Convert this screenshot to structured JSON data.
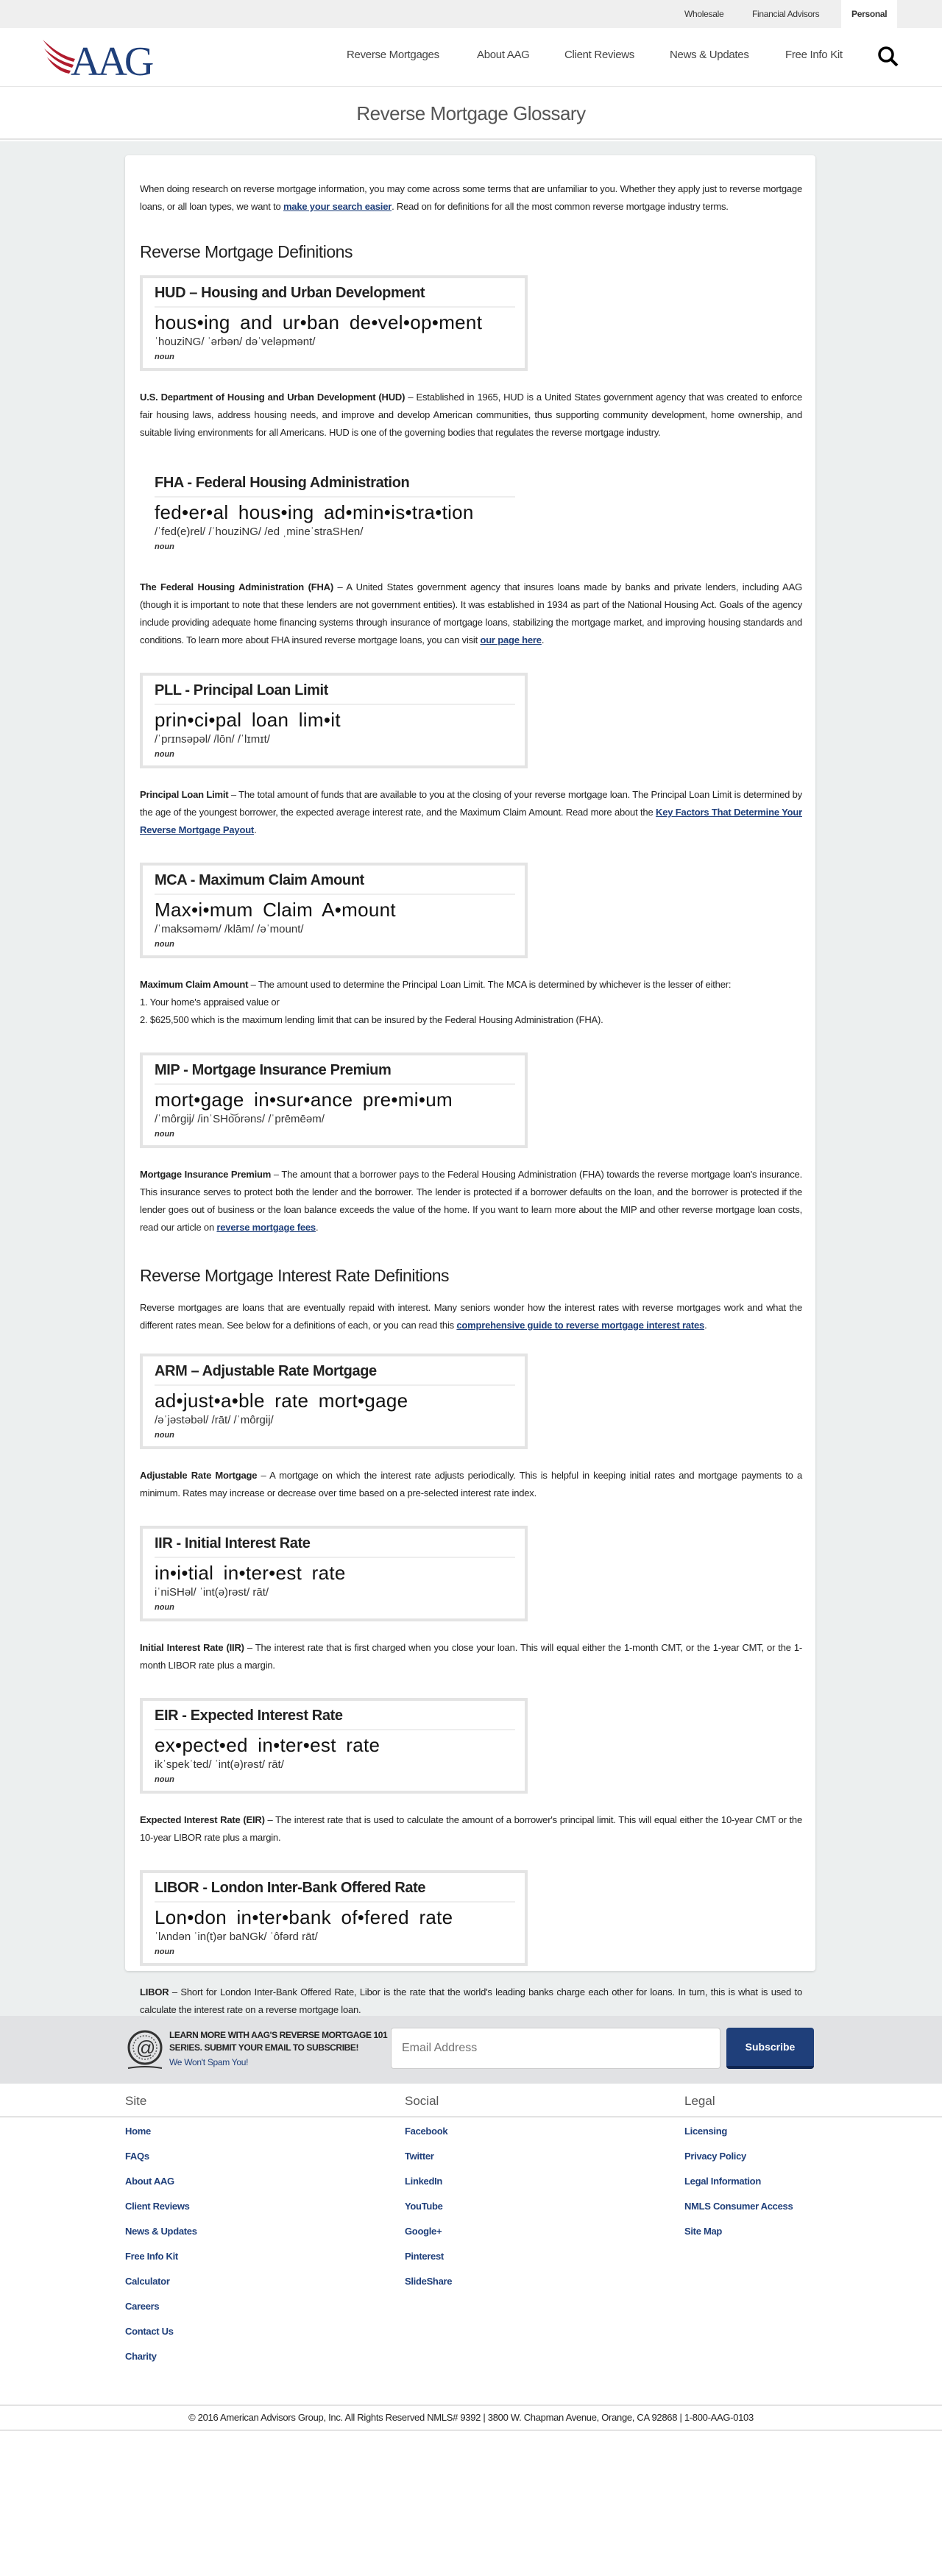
{
  "topbar": {
    "items": [
      {
        "label": "Wholesale"
      },
      {
        "label": "Financial Advisors"
      },
      {
        "label": "Personal",
        "active": true
      }
    ]
  },
  "header": {
    "logo": "AAG",
    "nav": [
      {
        "label": "Reverse Mortgages"
      },
      {
        "label": "About AAG"
      },
      {
        "label": "Client Reviews"
      },
      {
        "label": "News & Updates"
      },
      {
        "label": "Free Info Kit"
      }
    ],
    "search_icon": "search-icon"
  },
  "colors": {
    "brand_blue": "#1f3f7a",
    "brand_red": "#b01c2e",
    "page_bg": "#ecefef"
  },
  "page_title": "Reverse Mortgage Glossary",
  "intro": [
    {
      "t": "When doing research on reverse mortgage information, you may come across some terms that are unfamiliar to you. Whether they apply just to reverse mortgage loans, or all loan types, we want to "
    },
    {
      "link": "make your search easier"
    },
    {
      "t": ". Read on for definitions for all the most common reverse mortgage industry terms."
    }
  ],
  "sections": [
    {
      "heading": "Reverse Mortgage Definitions",
      "terms": [
        {
          "title": "HUD – Housing and Urban Development",
          "pron": "hous•ing and ur•ban de•vel•op•ment",
          "phon": "ˈhouziNG/  ˈərbən/  dəˈveləpmənt/",
          "pos": "noun",
          "bordered": true,
          "def": [
            {
              "b": "U.S. Department of Housing and Urban Development (HUD)"
            },
            {
              "t": " – Established in 1965, HUD is a United States government agency that was created to enforce fair housing laws, address housing needs, and improve and develop American communities, thus supporting community development, home ownership, and suitable living environments for all Americans. HUD is one of the governing bodies that regulates the reverse mortgage industry."
            }
          ]
        },
        {
          "title": "FHA  -  Federal Housing Administration",
          "pron": "fed•er•al hous•ing  ad•min•is•tra•tion",
          "phon": "/ˈfed(e)rel/  /ˈhouziNG/  /ed ˌmineˈstraSHen/",
          "pos": "noun",
          "bordered": false,
          "def": [
            {
              "b": "The Federal Housing Administration (FHA)"
            },
            {
              "t": " – A United States government agency that insures loans made by banks and private lenders, including AAG (though it is important to note that these lenders are not government entities). It was established in 1934 as part of the National Housing Act. Goals of the agency include providing adequate home financing systems through insurance of mortgage loans, stabilizing the mortgage market, and improving housing standards and conditions. To learn more about FHA insured reverse mortgage loans, you can visit "
            },
            {
              "link": "our page here"
            },
            {
              "t": "."
            }
          ]
        },
        {
          "title": "PLL - Principal Loan Limit",
          "pron": "prin•ci•pal loan lim•it",
          "phon": "/ˈprɪnsəpəl/  /lōn/  /ˈlɪmɪt/",
          "pos": "noun",
          "bordered": true,
          "def": [
            {
              "b": "Principal Loan Limit"
            },
            {
              "t": " – The total amount of funds that are available to you at the closing of your reverse mortgage loan.  The Principal Loan Limit is determined by the age of the youngest borrower, the expected average interest rate, and the Maximum Claim Amount. Read more about the "
            },
            {
              "link": "Key Factors That Determine Your Reverse Mortgage Payout"
            },
            {
              "t": "."
            }
          ]
        },
        {
          "title": "MCA - Maximum Claim Amount",
          "pron": "Max•i•mum  Claim  A•mount",
          "phon": "/ˈmaksəməm/  /klām/  /əˈmount/",
          "pos": "noun",
          "bordered": true,
          "def": [
            {
              "b": "Maximum Claim Amount"
            },
            {
              "t": " – The amount used to determine the Principal Loan Limit. The MCA is determined by whichever is the lesser of either:"
            },
            {
              "br": "1. Your home's appraised value or"
            },
            {
              "br": "2. $625,500 which is the maximum lending limit that can be insured by the Federal Housing Administration (FHA)."
            }
          ]
        },
        {
          "title": "MIP - Mortgage Insurance Premium",
          "pron": "mort•gage  in•sur•ance  pre•mi•um",
          "phon": "/ˈmôrgij/  /inˈSHo͝orəns/  /ˈprēmēəm/",
          "pos": "noun",
          "bordered": true,
          "def": [
            {
              "b": "Mortgage Insurance Premium"
            },
            {
              "t": " – The amount that a borrower pays to the Federal Housing Administration (FHA) towards the reverse mortgage loan's insurance.  This insurance serves to protect both the lender and the borrower.  The lender is protected if a borrower defaults on the loan, and the borrower is protected if the lender goes out of business or the loan balance exceeds the value of the home. If you want to learn more about the MIP and other reverse mortgage loan costs, read our article on "
            },
            {
              "link": "reverse mortgage fees"
            },
            {
              "t": "."
            }
          ]
        }
      ]
    },
    {
      "heading": "Reverse Mortgage Interest Rate Definitions",
      "intro": [
        {
          "t": "Reverse mortgages are loans that are eventually repaid with interest. Many seniors wonder how the interest rates with reverse mortgages work and what the different rates mean. See below for a definitions of each, or you can read this "
        },
        {
          "link": "comprehensive guide to reverse mortgage interest rates"
        },
        {
          "t": "."
        }
      ],
      "terms": [
        {
          "title": "ARM – Adjustable Rate Mortgage",
          "pron": "ad•just•a•ble  rate  mort•gage",
          "phon": "/əˈjəstəbəl/  /rāt/  /ˈmôrgij/",
          "pos": "noun",
          "bordered": true,
          "def": [
            {
              "b": "Adjustable Rate Mortgage"
            },
            {
              "t": " – A mortgage on which the interest rate adjusts periodically.  This is helpful in keeping initial rates and mortgage payments to a minimum. Rates may increase or decrease over time based on a pre-selected interest rate index."
            }
          ]
        },
        {
          "title": "IIR - Initial Interest Rate",
          "pron": "in•i•tial in•ter•est rate",
          "phon": "iˈniSHəl/ ˈint(ə)rəst/ rāt/",
          "pos": "noun",
          "bordered": true,
          "def": [
            {
              "b": "Initial Interest Rate (IIR)"
            },
            {
              "t": " – The interest rate that is first charged when you close your loan.  This will equal either the 1-month CMT, or the 1-year CMT, or the 1-month LIBOR rate plus a margin."
            }
          ]
        },
        {
          "title": "EIR - Expected Interest Rate",
          "pron": "ex•pect•ed in•ter•est rate",
          "phon": "ikˈspekˈted/  ˈint(ə)rəst/  rāt/",
          "pos": "noun",
          "bordered": true,
          "def": [
            {
              "b": "Expected Interest Rate (EIR)"
            },
            {
              "t": " – The interest rate that is used to calculate the amount of a borrower's principal limit.  This will equal either the 10-year CMT or the 10-year LIBOR rate plus a margin."
            }
          ]
        },
        {
          "title": "LIBOR - London Inter-Bank Offered Rate",
          "pron": "Lon•don in•ter•bank of•fered rate",
          "phon": "ˈlʌndən  ˈin(t)ər baNGk/  ˈôfərd rāt/",
          "pos": "noun",
          "bordered": true,
          "def": [
            {
              "b": "LIBOR"
            },
            {
              "t": " – Short for London Inter-Bank Offered Rate, Libor is the rate that the world's leading banks charge each other for loans.  In turn, this is what is used to calculate the interest rate on a reverse mortgage loan."
            }
          ]
        }
      ]
    }
  ],
  "newsletter": {
    "line1": "LEARN MORE WITH AAG'S REVERSE MORTGAGE 101 SERIES. SUBMIT YOUR EMAIL TO SUBSCRIBE!",
    "line2": "We Won't Spam You!",
    "placeholder": "Email Address",
    "value": "",
    "button": "Subscribe",
    "icon": "at-sign-icon"
  },
  "footer": {
    "columns": [
      {
        "heading": "Site",
        "links": [
          "Home",
          "FAQs",
          "About AAG",
          "Client Reviews",
          "News & Updates",
          "Free Info Kit",
          "Calculator",
          "Careers",
          "Contact Us",
          "Charity"
        ]
      },
      {
        "heading": "Social",
        "links": [
          "Facebook",
          "Twitter",
          "LinkedIn",
          "YouTube",
          "Google+",
          "Pinterest",
          "SlideShare"
        ]
      },
      {
        "heading": "Legal",
        "links": [
          "Licensing",
          "Privacy Policy",
          "Legal Information",
          "NMLS Consumer Access",
          "Site Map"
        ]
      }
    ],
    "copyright": "© 2016 American Advisors Group, Inc. All Rights Reserved NMLS# 9392 | 3800 W. Chapman Avenue, Orange, CA 92868 | 1-800-AAG-0103"
  }
}
